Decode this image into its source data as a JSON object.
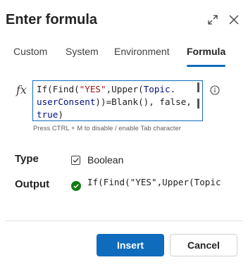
{
  "dialog": {
    "title": "Enter formula"
  },
  "tabs": [
    {
      "label": "Custom",
      "active": false
    },
    {
      "label": "System",
      "active": false
    },
    {
      "label": "Environment",
      "active": false
    },
    {
      "label": "Formula",
      "active": true
    }
  ],
  "editor": {
    "fx_symbol": "fx",
    "line1": {
      "a": "If(Find(",
      "b": "\"YES\"",
      "c": ",Upper(",
      "d": "Topic."
    },
    "line2": {
      "a": "userConsent",
      "b": "))=Blank(), false,"
    },
    "line3": {
      "a": "true",
      "b": ")"
    },
    "hint": "Press CTRL + M to disable / enable Tab character"
  },
  "type": {
    "label": "Type",
    "value": "Boolean",
    "checked": true
  },
  "output": {
    "label": "Output",
    "value": "If(Find(\"YES\",Upper(Topic"
  },
  "footer": {
    "insert_label": "Insert",
    "cancel_label": "Cancel"
  },
  "colors": {
    "accent": "#0f6cbd",
    "success": "#107c10"
  }
}
